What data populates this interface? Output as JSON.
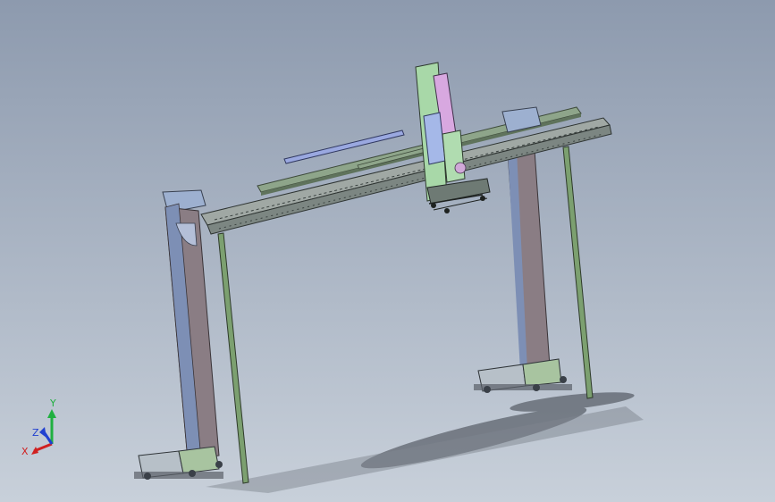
{
  "viewport": {
    "background_top": "#8d9aae",
    "background_bottom": "#c8d0da"
  },
  "model": {
    "frame_color": "#7a6f7a",
    "beam_color": "#8a9488",
    "rail_color": "#6e8a6a",
    "base_color": "#9aa3ab",
    "carriage_colors": [
      "#9fd3a0",
      "#d8a0d8",
      "#9db3e0"
    ]
  },
  "triad": {
    "x_label": "X",
    "y_label": "Y",
    "z_label": "Z",
    "x_color": "#d02020",
    "y_color": "#20b040",
    "z_color": "#2040d0"
  }
}
